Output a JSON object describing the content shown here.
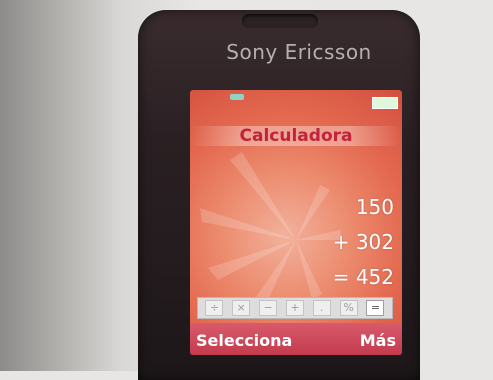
{
  "phone": {
    "brand": "Sony Ericsson"
  },
  "screen": {
    "title": "Calculadora",
    "display": {
      "line1": "150",
      "line2": "+ 302",
      "line3": "= 452"
    },
    "operators": [
      {
        "label": "÷",
        "name": "divide"
      },
      {
        "label": "×",
        "name": "multiply"
      },
      {
        "label": "−",
        "name": "subtract"
      },
      {
        "label": "+",
        "name": "add"
      },
      {
        "label": ".",
        "name": "decimal"
      },
      {
        "label": "%",
        "name": "percent"
      },
      {
        "label": "=",
        "name": "equals"
      }
    ],
    "softkeys": {
      "left": "Selecciona",
      "right": "Más"
    }
  }
}
